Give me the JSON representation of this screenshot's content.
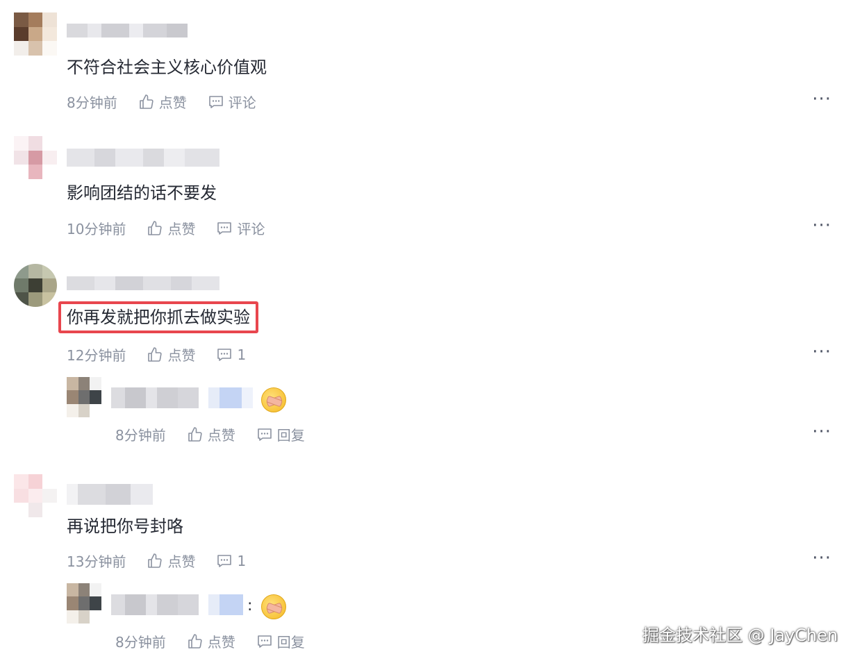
{
  "comments": [
    {
      "text": "不符合社会主义核心价值观",
      "time": "8分钟前",
      "like_label": "点赞",
      "comment_label": "评论"
    },
    {
      "text": "影响团结的话不要发",
      "time": "10分钟前",
      "like_label": "点赞",
      "comment_label": "评论"
    },
    {
      "text": "你再发就把你抓去做实验",
      "time": "12分钟前",
      "like_label": "点赞",
      "comment_label": "1",
      "highlight_color": "#e8464e"
    },
    {
      "text": "再说把你号封咯",
      "time": "13分钟前",
      "like_label": "点赞",
      "comment_label": "1"
    }
  ],
  "replies": [
    {
      "time": "8分钟前",
      "like_label": "点赞",
      "reply_label": "回复",
      "emoji": "zipper-mouth-emoji"
    },
    {
      "time": "8分钟前",
      "like_label": "点赞",
      "reply_label": "回复",
      "separator": ":",
      "emoji": "zipper-mouth-emoji"
    }
  ],
  "more_label": "···",
  "watermark": "掘金技术社区 @ JayChen",
  "colors": {
    "meta_text": "#8a919f",
    "body_text": "#252933",
    "highlight": "#e8464e"
  }
}
